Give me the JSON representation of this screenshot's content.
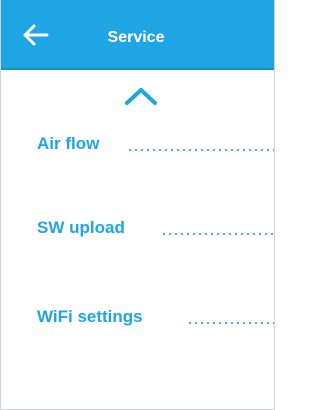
{
  "header": {
    "title": "Service",
    "back_icon": "arrow-left-icon"
  },
  "scroll": {
    "icon": "chevron-up-icon"
  },
  "menu": {
    "items": [
      {
        "label": "Air flow"
      },
      {
        "label": "SW upload"
      },
      {
        "label": "WiFi settings"
      }
    ]
  },
  "colors": {
    "accent": "#1fa5e3",
    "header_text": "#ffffff",
    "background": "#ffffff"
  }
}
